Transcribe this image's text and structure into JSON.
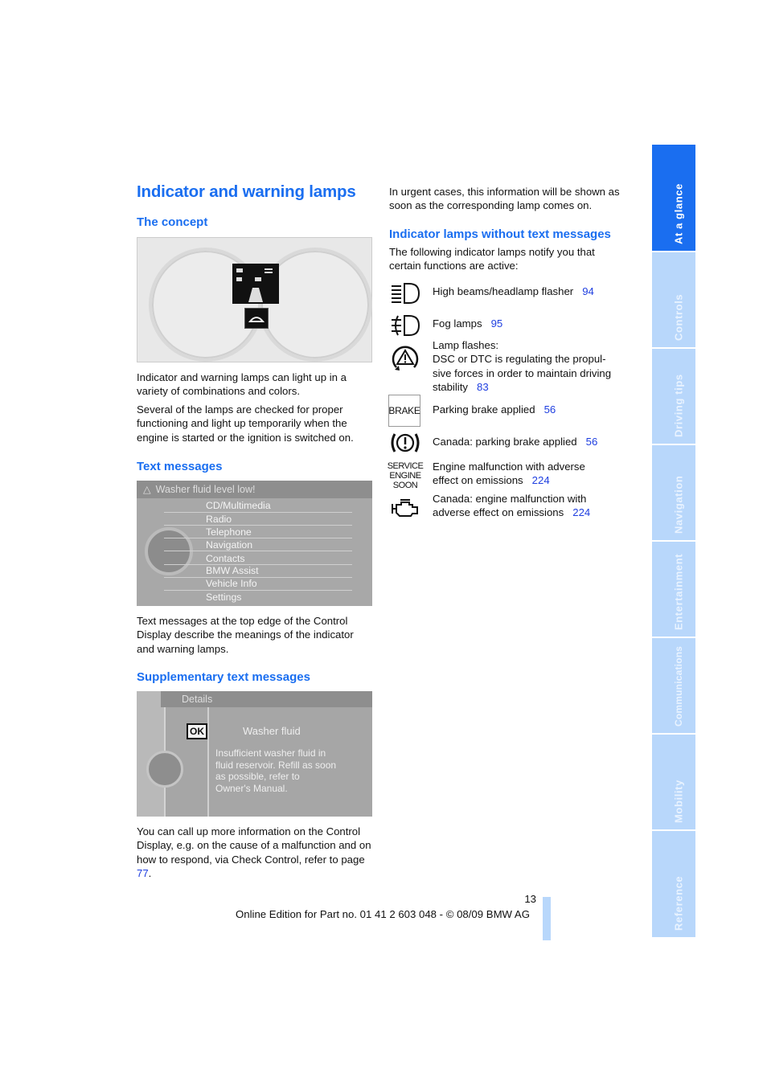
{
  "page": {
    "title": "Indicator and warning lamps",
    "page_number": "13",
    "footer": "Online Edition for Part no. 01 41 2 603 048 - © 08/09 BMW AG"
  },
  "left_column": {
    "concept_heading": "The concept",
    "concept_para1": "Indicator and warning lamps can light up in a variety of combinations and colors.",
    "concept_para2": "Several of the lamps are checked for proper functioning and light up temporarily when the engine is started or the ignition is switched on.",
    "text_messages_heading": "Text messages",
    "menu_screen": {
      "warning": "Washer fluid level low!",
      "items": [
        "CD/Multimedia",
        "Radio",
        "Telephone",
        "Navigation",
        "Contacts",
        "BMW Assist",
        "Vehicle Info",
        "Settings"
      ]
    },
    "text_messages_para": "Text messages at the top edge of the Control Display describe the meanings of the indicator and warning lamps.",
    "supplementary_heading": "Supplementary text messages",
    "details_screen": {
      "header": "Details",
      "ok_label": "OK",
      "title": "Washer fluid",
      "body_lines": [
        "Insufficient washer fluid in",
        "fluid reservoir. Refill as soon",
        "as possible, refer to",
        "Owner's Manual."
      ]
    },
    "supplementary_para": "You can call up more information on the Control Display, e.g. on the cause of a malfunction and on how to respond, via Check Control, refer to page",
    "supplementary_page_ref": "77",
    "supplementary_end": "."
  },
  "right_column": {
    "intro_para": "In urgent cases, this information will be shown as soon as the corresponding lamp comes on.",
    "indicator_heading": "Indicator lamps without text messages",
    "indicator_intro": "The following indicator lamps notify you that certain functions are active:",
    "lamps": [
      {
        "icon": "high-beam-icon",
        "text": "High beams/headlamp flasher",
        "page": "94"
      },
      {
        "icon": "fog-lamp-icon",
        "text": "Fog lamps",
        "page": "95"
      },
      {
        "icon": "dsc-icon",
        "text_lines": [
          "Lamp flashes:",
          "DSC or DTC is regulating the propul-",
          "sive forces in order to maintain driving",
          "stability"
        ],
        "page": "83"
      },
      {
        "icon": "brake-icon",
        "icon_text": "BRAKE",
        "text": "Parking brake applied",
        "page": "56"
      },
      {
        "icon": "parking-brake-canada-icon",
        "text": "Canada: parking brake applied",
        "page": "56"
      },
      {
        "icon": "service-engine-soon-icon",
        "icon_text_lines": [
          "SERVICE",
          "ENGINE",
          "SOON"
        ],
        "text_lines": [
          "Engine malfunction with adverse",
          "effect on emissions"
        ],
        "page": "224"
      },
      {
        "icon": "engine-icon",
        "text_lines": [
          "Canada: engine malfunction with",
          "adverse effect on emissions"
        ],
        "page": "224"
      }
    ]
  },
  "side_tabs": [
    {
      "label": "At a glance",
      "active": true
    },
    {
      "label": "Controls",
      "active": false
    },
    {
      "label": "Driving tips",
      "active": false
    },
    {
      "label": "Navigation",
      "active": false
    },
    {
      "label": "Entertainment",
      "active": false
    },
    {
      "label": "Communications",
      "active": false
    },
    {
      "label": "Mobility",
      "active": false
    },
    {
      "label": "Reference",
      "active": false
    }
  ],
  "colors": {
    "heading_blue": "#1a6ef0",
    "link_blue": "#1f3fe0",
    "tab_active": "#1a6ef0",
    "tab_inactive": "#b8d7fb"
  }
}
